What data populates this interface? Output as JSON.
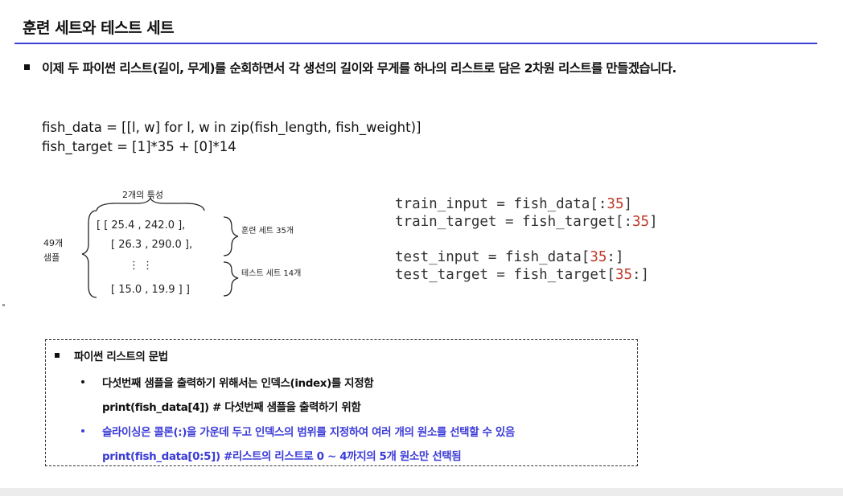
{
  "title": "훈련 세트와 테스트 세트",
  "intro": "이제 두 파이썬 리스트(길이, 무게)를 순회하면서 각 생선의 길이와 무게를 하나의 리스트로 담은 2차원 리스트를 만들겠습니다.",
  "code_main": [
    "fish_data = [[l, w] for l, w in zip(fish_length, fish_weight)]",
    "fish_target = [1]*35 + [0]*14"
  ],
  "handwritten": {
    "top_label": "2개의 특성",
    "side_label_1": "49개",
    "side_label_2": "샘플",
    "rows": [
      "[ [ 25.4 , 242.0 ],",
      "[ 26.3 , 290.0 ],",
      "⋮        ⋮",
      "[ 15.0 , 19.9 ] ]"
    ],
    "train_label": "훈련 세트 35개",
    "test_label": "테스트 세트 14개"
  },
  "code_right": [
    {
      "pre": "train_input = fish_data[:",
      "num": "35",
      "post": "]"
    },
    {
      "pre": "train_target = fish_target[:",
      "num": "35",
      "post": "]"
    },
    {
      "pre": "test_input = fish_data[",
      "num": "35",
      "post": ":]"
    },
    {
      "pre": "test_target = fish_target[",
      "num": "35",
      "post": ":]"
    }
  ],
  "box": {
    "heading": "파이썬 리스트의 문법",
    "item1": "다섯번째 샘플을 출력하기 위해서는 인덱스(index)를 지정함",
    "code1": "print(fish_data[4]) # 다섯번째 샘플을 출력하기 위함",
    "item2": "슬라이싱은 콜론(:)을 가운데 두고 인덱스의 범위를 지정하여 여러 개의 원소를 선택할 수 있음",
    "code2": "print(fish_data[0:5]) #리스트의 리스트로 0 ~ 4까지의 5개 원소만 선택됨"
  },
  "colors": {
    "accent": "#3f3fd6",
    "blue_text": "#3b3bd8",
    "number_red": "#c0392b"
  }
}
